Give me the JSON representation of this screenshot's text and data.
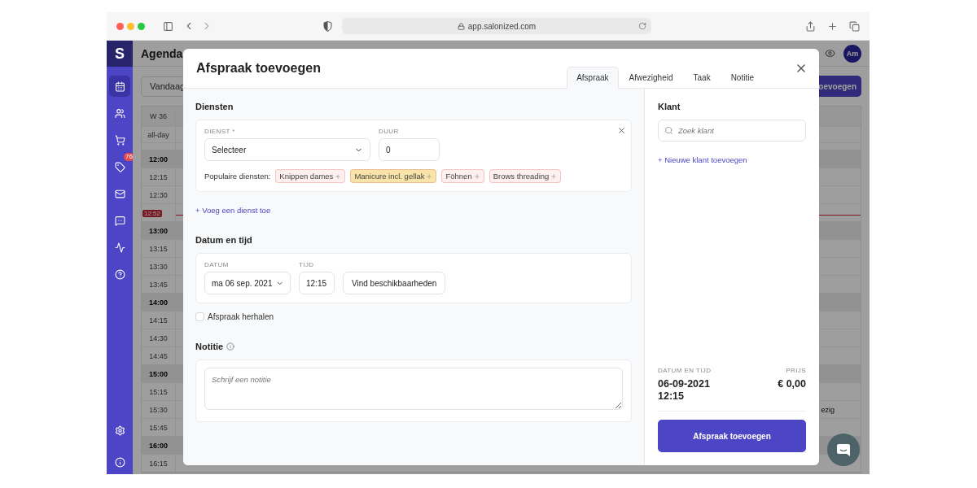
{
  "browser": {
    "url": "app.salonized.com"
  },
  "sidebar": {
    "logo": "S",
    "top_items": [
      {
        "selected": true
      },
      {
        "selected": false
      },
      {
        "selected": false
      },
      {
        "selected": false,
        "badge": "76"
      },
      {
        "selected": false
      },
      {
        "selected": false
      },
      {
        "selected": false
      },
      {
        "selected": false
      }
    ],
    "bottom_items": [
      {
        "selected": false
      },
      {
        "selected": false
      }
    ]
  },
  "agenda": {
    "title": "Agenda",
    "avatar": "Am",
    "today_button": "Vandaag",
    "add_button": "oevoegen",
    "week": "W 36",
    "all_day": "all-day",
    "now": "12:52",
    "times": [
      {
        "label": "12:00",
        "hour": true
      },
      {
        "label": "12:15",
        "hour": false
      },
      {
        "label": "12:30",
        "hour": false
      },
      {
        "now": true
      },
      {
        "label": "13:00",
        "hour": true
      },
      {
        "label": "13:15",
        "hour": false
      },
      {
        "label": "13:30",
        "hour": false
      },
      {
        "label": "13:45",
        "hour": false
      },
      {
        "label": "14:00",
        "hour": true
      },
      {
        "label": "14:15",
        "hour": false
      },
      {
        "label": "14:30",
        "hour": false
      },
      {
        "label": "14:45",
        "hour": false
      },
      {
        "label": "15:00",
        "hour": true
      },
      {
        "label": "15:15",
        "hour": false
      },
      {
        "label": "15:30",
        "hour": false,
        "event_text": "ezig"
      },
      {
        "label": "15:45",
        "hour": false
      },
      {
        "label": "16:00",
        "hour": true
      },
      {
        "label": "16:15",
        "hour": false
      }
    ]
  },
  "modal": {
    "title": "Afspraak toevoegen",
    "tabs": [
      {
        "label": "Afspraak",
        "selected": true
      },
      {
        "label": "Afwezigheid",
        "selected": false
      },
      {
        "label": "Taak",
        "selected": false
      },
      {
        "label": "Notitie",
        "selected": false
      }
    ],
    "services": {
      "heading": "Diensten",
      "service_label": "DIENST *",
      "service_value": "Selecteer",
      "duration_label": "DUUR",
      "duration_value": "0",
      "popular_label": "Populaire diensten:",
      "popular": [
        {
          "label": "Knippen dames",
          "color": "#fdf0ef"
        },
        {
          "label": "Manicure incl. gellak",
          "color": "#f8e4a8"
        },
        {
          "label": "Föhnen",
          "color": "#fdf0ef"
        },
        {
          "label": "Brows threading",
          "color": "#fdf0ef"
        }
      ],
      "add_link": "+ Voeg een dienst toe"
    },
    "datetime": {
      "heading": "Datum en tijd",
      "date_label": "DATUM",
      "date_value": "ma 06 sep. 2021",
      "time_label": "TIJD",
      "time_value": "12:15",
      "find_button": "Vind beschikbaarheden"
    },
    "repeat": {
      "label": "Afspraak herhalen",
      "checked": false
    },
    "note": {
      "heading": "Notitie",
      "placeholder": "Schrijf een notitie"
    },
    "customer": {
      "heading": "Klant",
      "search_placeholder": "Zoek klant",
      "add_link": "+ Nieuwe klant toevoegen"
    },
    "summary": {
      "datetime_label": "DATUM EN TIJD",
      "date": "06-09-2021",
      "time": "12:15",
      "price_label": "PRIJS",
      "price": "€ 0,00"
    },
    "submit": "Afspraak toevoegen"
  }
}
